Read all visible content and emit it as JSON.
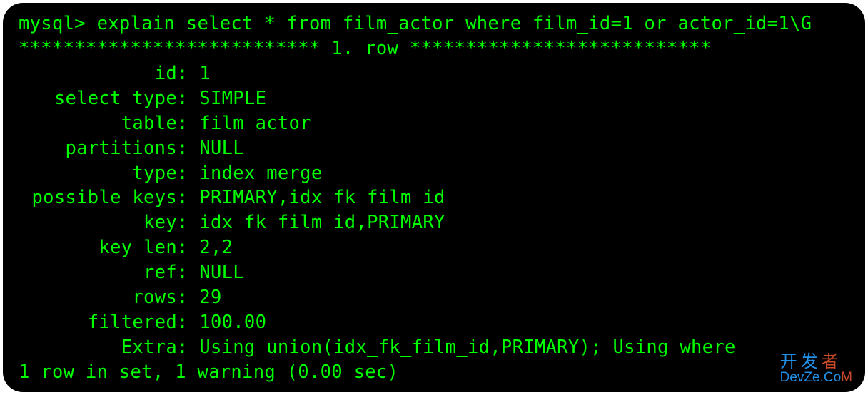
{
  "cmd": {
    "prompt": "mysql>",
    "command": " explain select * from film_actor where film_id=1 or actor_id=1\\G"
  },
  "divider": "*************************** 1. row ***************************",
  "rows": [
    {
      "label": "id",
      "value": "1"
    },
    {
      "label": "select_type",
      "value": "SIMPLE"
    },
    {
      "label": "table",
      "value": "film_actor"
    },
    {
      "label": "partitions",
      "value": "NULL"
    },
    {
      "label": "type",
      "value": "index_merge"
    },
    {
      "label": "possible_keys",
      "value": "PRIMARY,idx_fk_film_id"
    },
    {
      "label": "key",
      "value": "idx_fk_film_id,PRIMARY"
    },
    {
      "label": "key_len",
      "value": "2,2"
    },
    {
      "label": "ref",
      "value": "NULL"
    },
    {
      "label": "rows",
      "value": "29"
    },
    {
      "label": "filtered",
      "value": "100.00"
    },
    {
      "label": "Extra",
      "value": "Using union(idx_fk_film_id,PRIMARY); Using where"
    }
  ],
  "footer": "1 row in set, 1 warning (0.00 sec)",
  "watermark": {
    "line1_main": "开发",
    "line1_last": "者",
    "line2_main": "DevZe.Co",
    "line2_last": "M"
  }
}
